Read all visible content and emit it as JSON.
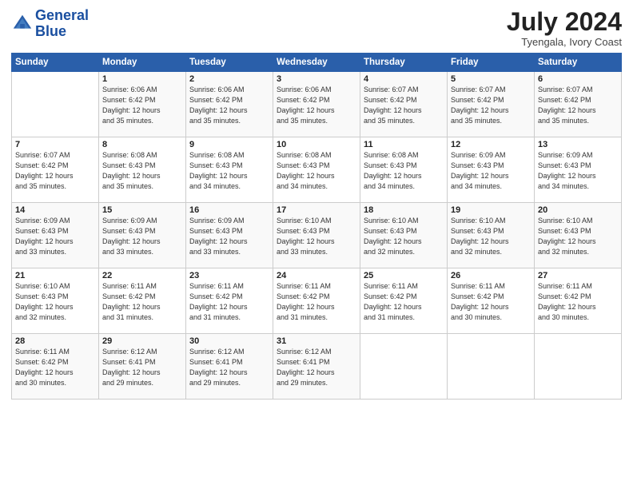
{
  "header": {
    "logo_line1": "General",
    "logo_line2": "Blue",
    "month": "July 2024",
    "location": "Tyengala, Ivory Coast"
  },
  "weekdays": [
    "Sunday",
    "Monday",
    "Tuesday",
    "Wednesday",
    "Thursday",
    "Friday",
    "Saturday"
  ],
  "weeks": [
    [
      {
        "day": "",
        "info": ""
      },
      {
        "day": "1",
        "info": "Sunrise: 6:06 AM\nSunset: 6:42 PM\nDaylight: 12 hours\nand 35 minutes."
      },
      {
        "day": "2",
        "info": "Sunrise: 6:06 AM\nSunset: 6:42 PM\nDaylight: 12 hours\nand 35 minutes."
      },
      {
        "day": "3",
        "info": "Sunrise: 6:06 AM\nSunset: 6:42 PM\nDaylight: 12 hours\nand 35 minutes."
      },
      {
        "day": "4",
        "info": "Sunrise: 6:07 AM\nSunset: 6:42 PM\nDaylight: 12 hours\nand 35 minutes."
      },
      {
        "day": "5",
        "info": "Sunrise: 6:07 AM\nSunset: 6:42 PM\nDaylight: 12 hours\nand 35 minutes."
      },
      {
        "day": "6",
        "info": "Sunrise: 6:07 AM\nSunset: 6:42 PM\nDaylight: 12 hours\nand 35 minutes."
      }
    ],
    [
      {
        "day": "7",
        "info": "Sunrise: 6:07 AM\nSunset: 6:42 PM\nDaylight: 12 hours\nand 35 minutes."
      },
      {
        "day": "8",
        "info": "Sunrise: 6:08 AM\nSunset: 6:43 PM\nDaylight: 12 hours\nand 35 minutes."
      },
      {
        "day": "9",
        "info": "Sunrise: 6:08 AM\nSunset: 6:43 PM\nDaylight: 12 hours\nand 34 minutes."
      },
      {
        "day": "10",
        "info": "Sunrise: 6:08 AM\nSunset: 6:43 PM\nDaylight: 12 hours\nand 34 minutes."
      },
      {
        "day": "11",
        "info": "Sunrise: 6:08 AM\nSunset: 6:43 PM\nDaylight: 12 hours\nand 34 minutes."
      },
      {
        "day": "12",
        "info": "Sunrise: 6:09 AM\nSunset: 6:43 PM\nDaylight: 12 hours\nand 34 minutes."
      },
      {
        "day": "13",
        "info": "Sunrise: 6:09 AM\nSunset: 6:43 PM\nDaylight: 12 hours\nand 34 minutes."
      }
    ],
    [
      {
        "day": "14",
        "info": "Sunrise: 6:09 AM\nSunset: 6:43 PM\nDaylight: 12 hours\nand 33 minutes."
      },
      {
        "day": "15",
        "info": "Sunrise: 6:09 AM\nSunset: 6:43 PM\nDaylight: 12 hours\nand 33 minutes."
      },
      {
        "day": "16",
        "info": "Sunrise: 6:09 AM\nSunset: 6:43 PM\nDaylight: 12 hours\nand 33 minutes."
      },
      {
        "day": "17",
        "info": "Sunrise: 6:10 AM\nSunset: 6:43 PM\nDaylight: 12 hours\nand 33 minutes."
      },
      {
        "day": "18",
        "info": "Sunrise: 6:10 AM\nSunset: 6:43 PM\nDaylight: 12 hours\nand 32 minutes."
      },
      {
        "day": "19",
        "info": "Sunrise: 6:10 AM\nSunset: 6:43 PM\nDaylight: 12 hours\nand 32 minutes."
      },
      {
        "day": "20",
        "info": "Sunrise: 6:10 AM\nSunset: 6:43 PM\nDaylight: 12 hours\nand 32 minutes."
      }
    ],
    [
      {
        "day": "21",
        "info": "Sunrise: 6:10 AM\nSunset: 6:43 PM\nDaylight: 12 hours\nand 32 minutes."
      },
      {
        "day": "22",
        "info": "Sunrise: 6:11 AM\nSunset: 6:42 PM\nDaylight: 12 hours\nand 31 minutes."
      },
      {
        "day": "23",
        "info": "Sunrise: 6:11 AM\nSunset: 6:42 PM\nDaylight: 12 hours\nand 31 minutes."
      },
      {
        "day": "24",
        "info": "Sunrise: 6:11 AM\nSunset: 6:42 PM\nDaylight: 12 hours\nand 31 minutes."
      },
      {
        "day": "25",
        "info": "Sunrise: 6:11 AM\nSunset: 6:42 PM\nDaylight: 12 hours\nand 31 minutes."
      },
      {
        "day": "26",
        "info": "Sunrise: 6:11 AM\nSunset: 6:42 PM\nDaylight: 12 hours\nand 30 minutes."
      },
      {
        "day": "27",
        "info": "Sunrise: 6:11 AM\nSunset: 6:42 PM\nDaylight: 12 hours\nand 30 minutes."
      }
    ],
    [
      {
        "day": "28",
        "info": "Sunrise: 6:11 AM\nSunset: 6:42 PM\nDaylight: 12 hours\nand 30 minutes."
      },
      {
        "day": "29",
        "info": "Sunrise: 6:12 AM\nSunset: 6:41 PM\nDaylight: 12 hours\nand 29 minutes."
      },
      {
        "day": "30",
        "info": "Sunrise: 6:12 AM\nSunset: 6:41 PM\nDaylight: 12 hours\nand 29 minutes."
      },
      {
        "day": "31",
        "info": "Sunrise: 6:12 AM\nSunset: 6:41 PM\nDaylight: 12 hours\nand 29 minutes."
      },
      {
        "day": "",
        "info": ""
      },
      {
        "day": "",
        "info": ""
      },
      {
        "day": "",
        "info": ""
      }
    ]
  ]
}
